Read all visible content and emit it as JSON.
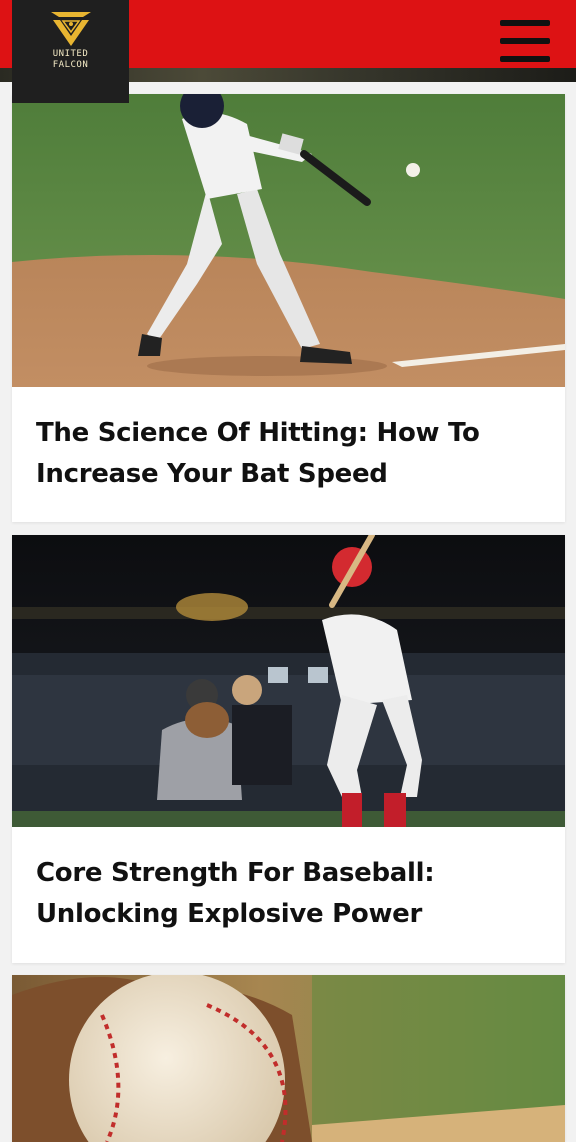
{
  "header": {
    "logo_lines": [
      "UNITED",
      "FALCON"
    ],
    "brand_color": "#dd1214",
    "menu_icon": "hamburger-menu-icon"
  },
  "articles": [
    {
      "title": "The Science Of Hitting: How To Increase Your Bat Speed",
      "image": "batter-swinging-at-pitch"
    },
    {
      "title": "Core Strength For Baseball: Unlocking Explosive Power",
      "image": "batter-catcher-umpire-night-stadium"
    },
    {
      "title": "",
      "image": "baseball-in-glove-on-field"
    }
  ]
}
